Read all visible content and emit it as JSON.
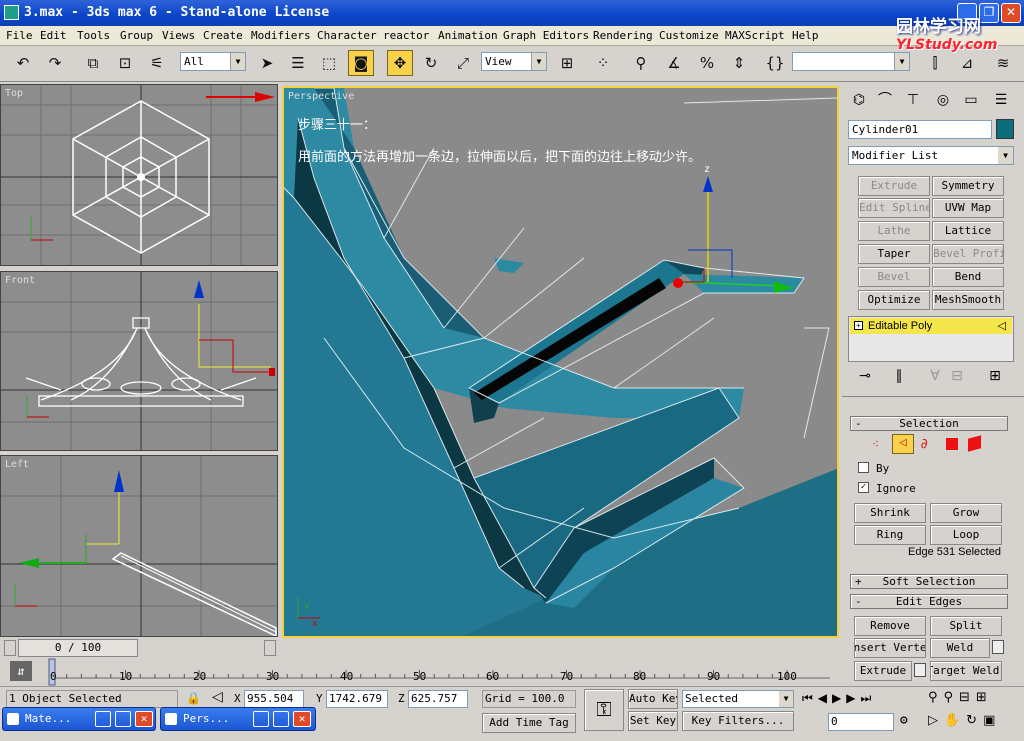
{
  "titlebar": {
    "title": "3.max - 3ds max 6 - Stand-alone License",
    "min": "_",
    "max": "❐",
    "close": "✕"
  },
  "watermark": {
    "line1": "园林学习网",
    "line2": "YLStudy.com"
  },
  "menu": [
    "File",
    "Edit",
    "Tools",
    "Group",
    "Views",
    "Create",
    "Modifiers",
    "Character",
    "reactor",
    "Animation",
    "Graph Editors",
    "Rendering",
    "Customize",
    "MAXScript",
    "Help"
  ],
  "toolbar": {
    "selection_filter": "All",
    "ref_coord": "View",
    "named_sel": ""
  },
  "viewports": {
    "top": {
      "label": "Top"
    },
    "front": {
      "label": "Front"
    },
    "left": {
      "label": "Left"
    },
    "perspective": {
      "label": "Perspective",
      "caption_title": "步骤三十一：",
      "caption_body": "用前面的方法再增加一条边，拉伸面以后，把下面的边往上移动少许。"
    }
  },
  "gizmo": {
    "x": "x",
    "y": "y",
    "z": "z"
  },
  "command_panel": {
    "object_name": "Cylinder01",
    "object_color": "#0a6f7a",
    "modifier_list": "Modifier List",
    "modifier_buttons": [
      {
        "label": "Extrude",
        "enabled": false
      },
      {
        "label": "Symmetry",
        "enabled": true
      },
      {
        "label": "Edit Spline",
        "enabled": false
      },
      {
        "label": "UVW Map",
        "enabled": true
      },
      {
        "label": "Lathe",
        "enabled": false
      },
      {
        "label": "Lattice",
        "enabled": true
      },
      {
        "label": "Taper",
        "enabled": true
      },
      {
        "label": "Bevel Profile",
        "enabled": false
      },
      {
        "label": "Bevel",
        "enabled": false
      },
      {
        "label": "Bend",
        "enabled": true
      },
      {
        "label": "Optimize",
        "enabled": true
      },
      {
        "label": "MeshSmooth",
        "enabled": true
      }
    ],
    "stack_item": "Editable Poly",
    "selection_rollout": {
      "title": "Selection",
      "by_label": "By",
      "by_checked": false,
      "ignore_label": "Ignore",
      "ignore_checked": true,
      "shrink": "Shrink",
      "grow": "Grow",
      "ring": "Ring",
      "loop": "Loop",
      "status": "Edge 531 Selected"
    },
    "soft_selection": "Soft Selection",
    "edit_edges": {
      "title": "Edit Edges",
      "remove": "Remove",
      "split": "Split",
      "insert_vertex": "Insert Vertex",
      "weld": "Weld",
      "extrude": "Extrude",
      "target_weld": "Target Weld"
    }
  },
  "time_slider": {
    "label": "0 / 100",
    "ticks": [
      "0",
      "10",
      "20",
      "30",
      "40",
      "50",
      "60",
      "70",
      "80",
      "90",
      "100"
    ],
    "current": 0,
    "end": 100
  },
  "status": {
    "selection": "1 Object Selected",
    "x_label": "X",
    "x": "955.504",
    "y_label": "Y",
    "y": "1742.679",
    "z_label": "Z",
    "z": "625.757",
    "grid": "Grid = 100.0",
    "add_time_tag": "Add Time Tag",
    "auto_key": "Auto Key",
    "set_key": "Set Key",
    "key_mode": "Selected",
    "key_filters": "Key Filters...",
    "frame": "0"
  },
  "taskbar": [
    {
      "label": "Mate..."
    },
    {
      "label": "Pers..."
    }
  ],
  "colors": {
    "accent": "#f4d13a",
    "mesh": "#1f6f86",
    "title": "#0a45c8"
  }
}
